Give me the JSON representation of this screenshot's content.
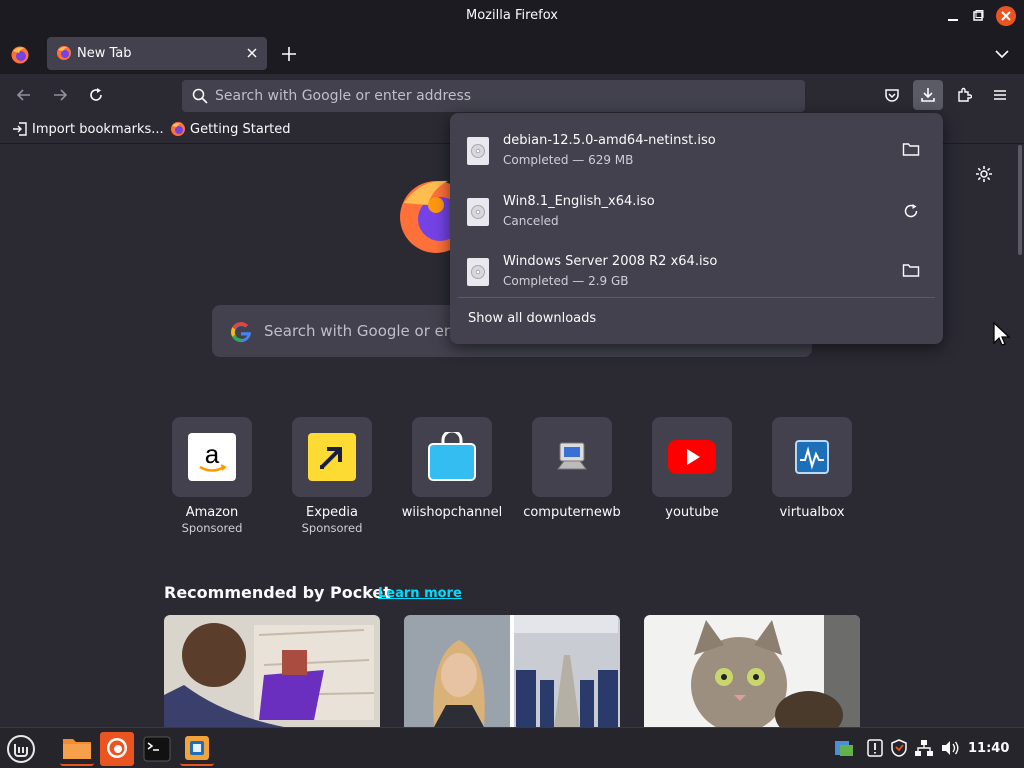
{
  "window": {
    "title": "Mozilla Firefox"
  },
  "tab": {
    "title": "New Tab"
  },
  "urlbar": {
    "placeholder": "Search with Google or enter address"
  },
  "bookmarks": [
    {
      "label": "Import bookmarks..."
    },
    {
      "label": "Getting Started"
    }
  ],
  "newtab": {
    "search_placeholder": "Search with Google or enter address",
    "shortcuts": [
      {
        "label": "Amazon",
        "sublabel": "Sponsored"
      },
      {
        "label": "Expedia",
        "sublabel": "Sponsored"
      },
      {
        "label": "wiishopchannel"
      },
      {
        "label": "computernewb"
      },
      {
        "label": "youtube"
      },
      {
        "label": "virtualbox"
      }
    ],
    "pocket": {
      "title": "Recommended by Pocket",
      "learn_more": "Learn more"
    }
  },
  "downloads": {
    "items": [
      {
        "name": "debian-12.5.0-amd64-netinst.iso",
        "status": "Completed — 629 MB",
        "action": "folder-icon"
      },
      {
        "name": "Win8.1_English_x64.iso",
        "status": "Canceled",
        "action": "retry-icon"
      },
      {
        "name": "Windows Server 2008 R2 x64.iso",
        "status": "Completed — 2.9 GB",
        "action": "folder-icon"
      }
    ],
    "show_all": "Show all downloads"
  },
  "taskbar": {
    "clock": "11:40"
  },
  "colors": {
    "accent": "#00ddff",
    "chrome": "#1c1b22",
    "content_bg": "#2b2a33",
    "surface": "#42414d",
    "close": "#e95420"
  }
}
